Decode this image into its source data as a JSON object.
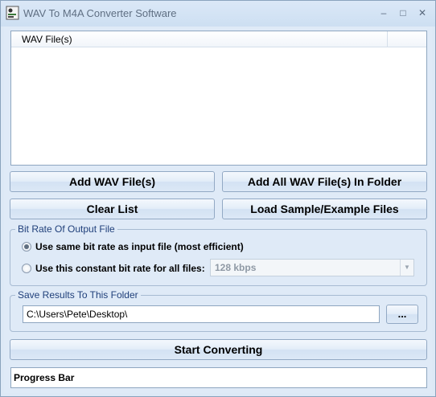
{
  "window": {
    "title": "WAV To M4A Converter Software",
    "minimize_glyph": "–",
    "maximize_glyph": "□",
    "close_glyph": "✕"
  },
  "file_list": {
    "column_header": "WAV File(s)",
    "items": []
  },
  "buttons": {
    "add_files": "Add WAV File(s)",
    "add_folder": "Add All WAV File(s) In Folder",
    "clear_list": "Clear List",
    "load_samples": "Load Sample/Example Files",
    "browse": "...",
    "start": "Start Converting"
  },
  "bitrate": {
    "legend": "Bit Rate Of Output File",
    "option_same": "Use same bit rate as input file (most efficient)",
    "option_constant": "Use this constant bit rate for all files:",
    "selected_option": "same",
    "constant_value": "128 kbps",
    "dropdown_arrow": "▼"
  },
  "output": {
    "legend": "Save Results To This Folder",
    "folder_path": "C:\\Users\\Pete\\Desktop\\"
  },
  "progress": {
    "label": "Progress Bar",
    "percent": 0
  },
  "colors": {
    "window_bg": "#dfeaf7",
    "legend_text": "#1f3f7a",
    "border": "#8ea6c0"
  },
  "icons": {
    "app": "app-icon",
    "minimize": "minimize-icon",
    "maximize": "maximize-icon",
    "close": "close-icon"
  }
}
